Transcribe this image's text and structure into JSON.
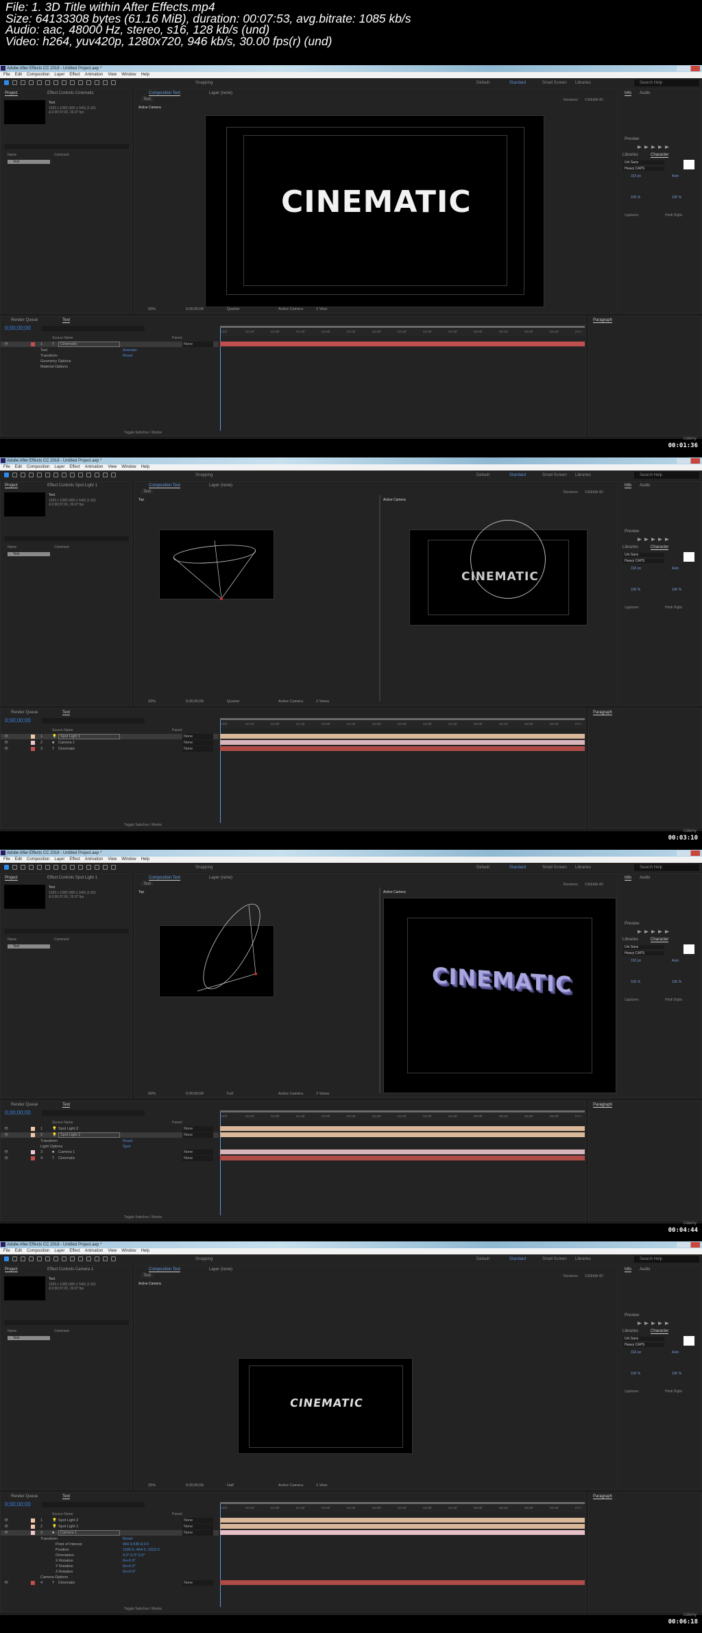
{
  "file_info": {
    "line1": "File: 1. 3D Title within After Effects.mp4",
    "line2": "Size: 64133308 bytes (61.16 MiB), duration: 00:07:53, avg.bitrate: 1085 kb/s",
    "line3": "Audio: aac, 48000 Hz, stereo, s16, 128 kb/s (und)",
    "line4": "Video: h264, yuv420p, 1280x720, 946 kb/s, 30.00 fps(r) (und)"
  },
  "app": {
    "window_title": "Adobe After Effects CC 2018 - Untitled Project.aep *",
    "menu": [
      "File",
      "Edit",
      "Composition",
      "Layer",
      "Effect",
      "Animation",
      "View",
      "Window",
      "Help"
    ],
    "snapping": "Snapping",
    "workspaces": [
      "Default",
      "Standard",
      "Small Screen",
      "Libraries"
    ],
    "search_placeholder": "Search Help",
    "project_tab": "Project",
    "comp_tab": "Composition Text",
    "layer_tab": "Layer (none)",
    "comp_subtab": "Text",
    "renderer_label": "Renderer:",
    "renderer": "CINEMA 4D",
    "info_tab": "Info",
    "audio_tab": "Audio",
    "preview_tab": "Preview",
    "libraries_tab": "Libraries",
    "character_tab": "Character",
    "font": "Uni Sans",
    "font_style": "Heavy CAPS",
    "font_size": "310 px",
    "leading": "Auto",
    "vscale": "100 %",
    "hscale": "100 %",
    "ligatures": "Ligatures",
    "hindi_digits": "Hindi Digits",
    "project_item": "Text",
    "project_item_info": "1920 x 1080 (960 x 540) (1.00)",
    "project_item_duration": "Δ 0;00;07;00, 29.97 fps",
    "name_col": "Name",
    "comment_col": "Comment",
    "render_queue": "Render Queue",
    "timeline_tab": "Text",
    "timecode": "0;00;00;00",
    "source_name_col": "Source Name",
    "parent_col": "Parent",
    "paragraph_tab": "Paragraph",
    "toggle_label": "Toggle Switches / Modes",
    "viewer_timecode": "0;00;00;00",
    "ruler_ticks": [
      "0:00f",
      "00:15f",
      "01:00f",
      "01:15f",
      "02:00f",
      "02:15f",
      "03:00f",
      "03:15f",
      "04:00f",
      "04:15f",
      "05:00f",
      "05:15f",
      "06:00f",
      "06:15f",
      "07:0"
    ],
    "comp_text": "CINEMATIC",
    "udemy": "Udemy"
  },
  "frames": [
    {
      "timestamp": "00:01:36",
      "effect_tab": "Effect Controls Cinematic",
      "split": false,
      "view_left_label": "Active Camera",
      "zoom": "50%",
      "resolution": "Quarter",
      "camera": "Active Camera",
      "views": "1 View",
      "layers": [
        {
          "num": "1",
          "name": "Cinematic",
          "type": "T",
          "color": "#c0504d",
          "parent": "None",
          "sel": true,
          "expanded": true
        }
      ],
      "props": [
        {
          "name": "Text",
          "value": "Animate:"
        },
        {
          "name": "Transform",
          "value": "Reset"
        },
        {
          "name": "Geometry Options",
          "value": ""
        },
        {
          "name": "Material Options",
          "value": ""
        }
      ],
      "tracks": [
        "#c0504d"
      ]
    },
    {
      "timestamp": "00:03:10",
      "effect_tab": "Effect Controls Spot Light 1",
      "split": true,
      "view_left_label": "Top",
      "view_right_label": "Active Camera",
      "zoom": "33%",
      "resolution": "Quarter",
      "camera": "Active Camera",
      "views": "2 Views",
      "layers": [
        {
          "num": "1",
          "name": "Spot Light 1",
          "type": "L",
          "color": "#f0c8a8",
          "parent": "None",
          "sel": true
        },
        {
          "num": "2",
          "name": "Camera 1",
          "type": "C",
          "color": "#f0c8d0",
          "parent": "None"
        },
        {
          "num": "3",
          "name": "Cinematic",
          "type": "T",
          "color": "#c0504d",
          "parent": "None"
        }
      ],
      "props": [],
      "tracks": [
        "#d9b89a",
        "#d8b4bb",
        "#b04c48"
      ]
    },
    {
      "timestamp": "00:04:44",
      "effect_tab": "Effect Controls Spot Light 1",
      "split": true,
      "view_left_label": "Top",
      "view_right_label": "Active Camera",
      "zoom": "50%",
      "resolution": "Full",
      "camera": "Active Camera",
      "views": "2 Views",
      "layers": [
        {
          "num": "1",
          "name": "Spot Light 2",
          "type": "L",
          "color": "#f0c8a8",
          "parent": "None"
        },
        {
          "num": "2",
          "name": "Spot Light 1",
          "type": "L",
          "color": "#f0c8a8",
          "parent": "None",
          "sel": true,
          "expanded": true
        },
        {
          "num": "3",
          "name": "Camera 1",
          "type": "C",
          "color": "#f0c8d0",
          "parent": "None"
        },
        {
          "num": "4",
          "name": "Cinematic",
          "type": "T",
          "color": "#c0504d",
          "parent": "None"
        }
      ],
      "props": [
        {
          "name": "Transform",
          "value": "Reset"
        },
        {
          "name": "Light Options",
          "value": "Spot"
        }
      ],
      "tracks": [
        "#d9b89a",
        "#d9b89a",
        "#d8b4bb",
        "#b04c48"
      ]
    },
    {
      "timestamp": "00:06:18",
      "effect_tab": "Effect Controls Camera 1",
      "split": false,
      "view_left_label": "Active Camera",
      "zoom": "25%",
      "resolution": "Half",
      "camera": "Active Camera",
      "views": "1 View",
      "layers": [
        {
          "num": "1",
          "name": "Spot Light 2",
          "type": "L",
          "color": "#f0c8a8",
          "parent": "None"
        },
        {
          "num": "2",
          "name": "Spot Light 1",
          "type": "L",
          "color": "#f0c8a8",
          "parent": "None"
        },
        {
          "num": "3",
          "name": "Camera 1",
          "type": "C",
          "color": "#f0c8d0",
          "parent": "None",
          "sel": true,
          "expanded": true
        }
      ],
      "props": [
        {
          "name": "Transform",
          "value": "Reset"
        },
        {
          "name": "Point of Interest",
          "value": "960.0,540.0,0.0"
        },
        {
          "name": "Position",
          "value": "1190.0,-464.0,-1522.0"
        },
        {
          "name": "Orientation",
          "value": "0.0°,0.0°,0.0°"
        },
        {
          "name": "X Rotation",
          "value": "0x+0.0°"
        },
        {
          "name": "Y Rotation",
          "value": "0x+0.0°"
        },
        {
          "name": "Z Rotation",
          "value": "0x+0.0°"
        },
        {
          "name": "Camera Options",
          "value": ""
        }
      ],
      "after_layers": [
        {
          "num": "4",
          "name": "Cinematic",
          "type": "T",
          "color": "#c0504d",
          "parent": "None"
        }
      ],
      "tracks": [
        "#d9b89a",
        "#d9b89a",
        "#e8c0c8",
        "#b04c48"
      ]
    }
  ]
}
